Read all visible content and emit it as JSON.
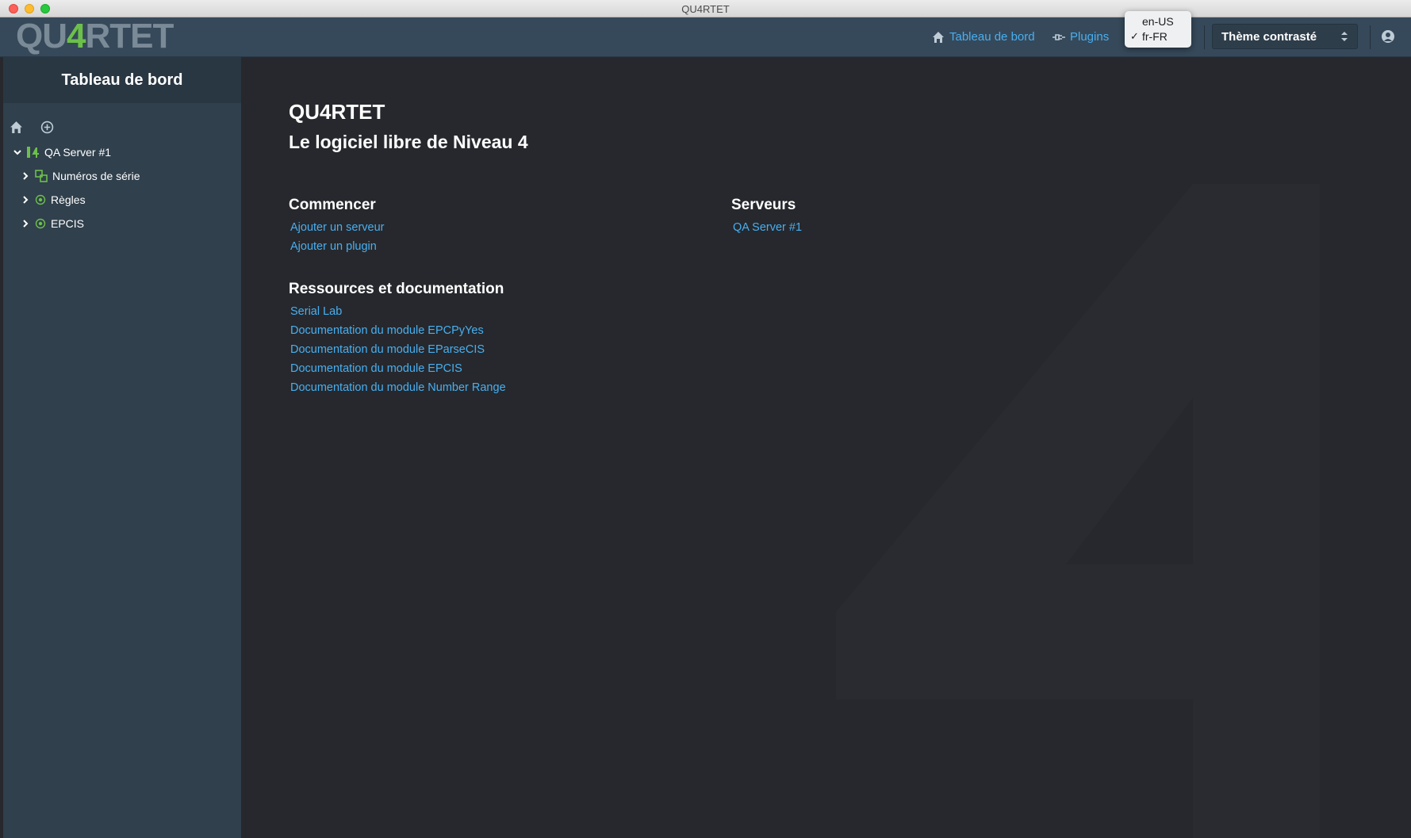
{
  "window": {
    "title": "QU4RTET"
  },
  "navbar": {
    "logo": {
      "prefix": "QU",
      "four": "4",
      "suffix": "RTET"
    },
    "dashboard_link": "Tableau de bord",
    "plugins_link": "Plugins",
    "language_menu": {
      "options": [
        "en-US",
        "fr-FR"
      ],
      "selected": "fr-FR",
      "check": "✓"
    },
    "theme_select": "Thème contrasté"
  },
  "sidebar": {
    "title": "Tableau de bord",
    "tree": {
      "server": "QA Server #1",
      "children": [
        "Numéros de série",
        "Règles",
        "EPCIS"
      ]
    }
  },
  "main": {
    "title": "QU4RTET",
    "subtitle": "Le logiciel libre de Niveau 4",
    "start": {
      "heading": "Commencer",
      "links": [
        "Ajouter un serveur",
        "Ajouter un plugin"
      ]
    },
    "servers": {
      "heading": "Serveurs",
      "links": [
        "QA Server #1"
      ]
    },
    "resources": {
      "heading": "Ressources et documentation",
      "links": [
        "Serial Lab",
        "Documentation du module EPCPyYes",
        "Documentation du module EParseCIS",
        "Documentation du module EPCIS",
        "Documentation du module Number Range"
      ]
    }
  },
  "colors": {
    "accent": "#48aff0",
    "brand_green": "#6cc04a",
    "sidebar": "#30404d",
    "background": "#26282d"
  }
}
